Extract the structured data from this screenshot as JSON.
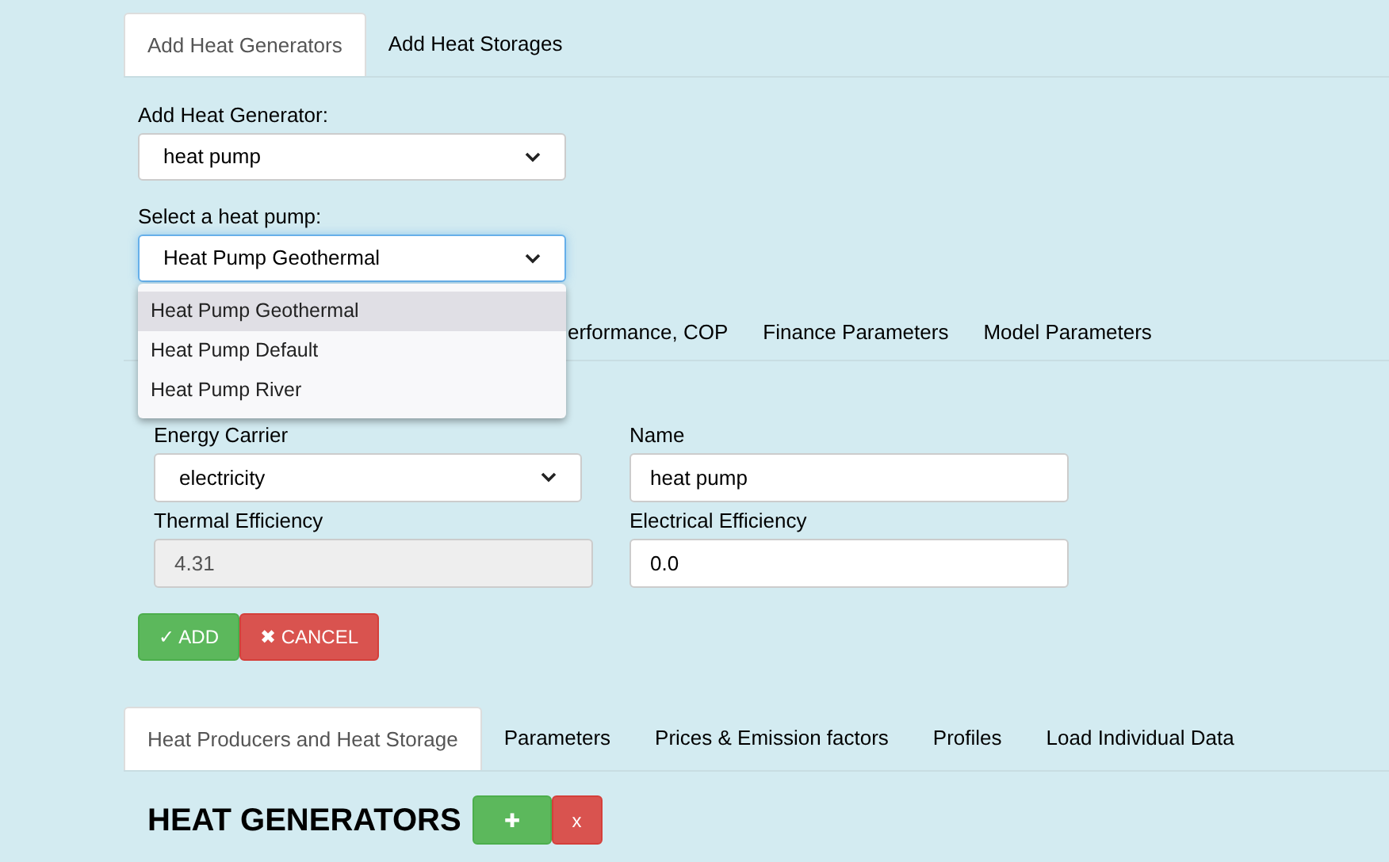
{
  "top_tabs": [
    {
      "label": "Add Heat Generators",
      "selected": true
    },
    {
      "label": "Add Heat Storages",
      "selected": false
    }
  ],
  "generator_type": {
    "label": "Add Heat Generator:",
    "value": "heat pump"
  },
  "heat_pump_select": {
    "label": "Select a heat pump:",
    "value": "Heat Pump Geothermal",
    "expanded": true,
    "options": [
      {
        "label": "Heat Pump Geothermal",
        "selected": true
      },
      {
        "label": "Heat Pump Default",
        "selected": false
      },
      {
        "label": "Heat Pump River",
        "selected": false
      }
    ]
  },
  "parameter_tabs": [
    {
      "label": "erformance, COP",
      "selected": false
    },
    {
      "label": "Finance Parameters",
      "selected": false
    },
    {
      "label": "Model Parameters",
      "selected": false
    }
  ],
  "fields": [
    {
      "kind": "select",
      "label": "Energy Carrier",
      "value": "electricity",
      "disabled": false
    },
    {
      "kind": "input",
      "label": "Name",
      "value": "heat pump",
      "disabled": false
    },
    {
      "kind": "input",
      "label": "Thermal Efficiency",
      "value": "4.31",
      "disabled": true
    },
    {
      "kind": "input",
      "label": "Electrical Efficiency",
      "value": "0.0",
      "disabled": false
    }
  ],
  "actions": [
    {
      "kind": "add",
      "label": "✓ ADD"
    },
    {
      "kind": "cancel",
      "label": "✖ CANCEL"
    }
  ],
  "main_tabs": [
    {
      "label": "Heat Producers and Heat Storage",
      "selected": true
    },
    {
      "label": "Parameters",
      "selected": false
    },
    {
      "label": "Prices & Emission factors",
      "selected": false
    },
    {
      "label": "Profiles",
      "selected": false
    },
    {
      "label": "Load Individual Data",
      "selected": false
    }
  ],
  "section": {
    "title": "HEAT GENERATORS",
    "buttons": [
      {
        "kind": "add",
        "label": "✚"
      },
      {
        "kind": "remove",
        "label": "x"
      }
    ]
  }
}
